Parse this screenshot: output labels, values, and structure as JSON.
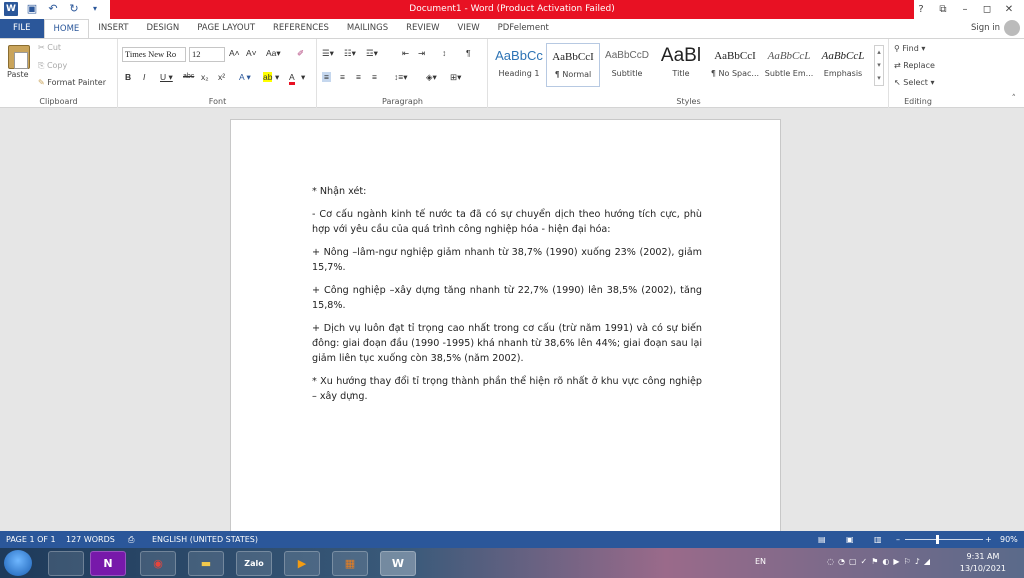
{
  "window": {
    "title": "Document1 - Word (Product Activation Failed)",
    "controls": [
      "?",
      "⧉",
      "–",
      "◻",
      "✕"
    ]
  },
  "tabs": [
    "FILE",
    "HOME",
    "INSERT",
    "DESIGN",
    "PAGE LAYOUT",
    "REFERENCES",
    "MAILINGS",
    "REVIEW",
    "VIEW",
    "PDFelement"
  ],
  "signin": "Sign in",
  "ribbon": {
    "clipboard": {
      "paste": "Paste",
      "cut": "Cut",
      "copy": "Copy",
      "format_painter": "Format Painter",
      "label": "Clipboard"
    },
    "font": {
      "name": "Times New Ro",
      "size": "12",
      "label": "Font"
    },
    "paragraph": {
      "label": "Paragraph"
    },
    "styles": {
      "label": "Styles",
      "items": [
        {
          "preview": "AaBbCc",
          "name": "Heading 1"
        },
        {
          "preview": "AaBbCcI",
          "name": "¶ Normal"
        },
        {
          "preview": "AaBbCcD",
          "name": "Subtitle"
        },
        {
          "preview": "AaBl",
          "name": "Title"
        },
        {
          "preview": "AaBbCcI",
          "name": "¶ No Spac..."
        },
        {
          "preview": "AaBbCcL",
          "name": "Subtle Em..."
        },
        {
          "preview": "AaBbCcL",
          "name": "Emphasis"
        }
      ]
    },
    "editing": {
      "find": "Find",
      "replace": "Replace",
      "select": "Select",
      "label": "Editing"
    }
  },
  "document": {
    "paragraphs": [
      "* Nhận xét:",
      "- Cơ cấu ngành kinh tế nước ta đã có sự chuyển dịch theo hướng tích cực, phù hợp với yêu cầu của quá trình công nghiệp hóa - hiện đại hóa:",
      "+ Nông –lâm-ngư nghiệp giảm nhanh từ 38,7% (1990) xuống 23% (2002), giảm 15,7%.",
      "+ Công nghiệp –xây dựng tăng nhanh từ 22,7% (1990) lên 38,5% (2002), tăng 15,8%.",
      "+ Dịch vụ luôn đạt tỉ trọng cao nhất trong cơ cấu (trừ năm 1991) và có sự biến đông: giai đoạn đầu (1990 -1995)  khá nhanh từ 38,6%  lên 44%; giai đoạn sau lại giảm liên tục xuống còn 38,5% (năm 2002).",
      "* Xu hướng thay đổi tỉ trọng thành phần thể hiện rõ nhất ở khu vực công nghiệp – xây dựng."
    ]
  },
  "status": {
    "page": "PAGE 1 OF 1",
    "words": "127 WORDS",
    "language": "ENGLISH (UNITED STATES)",
    "zoom": "90%"
  },
  "taskbar": {
    "apps": [
      "",
      "",
      "N",
      "",
      "",
      "Zalo",
      "",
      "",
      "W"
    ],
    "tray_lang": "EN",
    "time": "9:31 AM",
    "date": "13/10/2021"
  }
}
